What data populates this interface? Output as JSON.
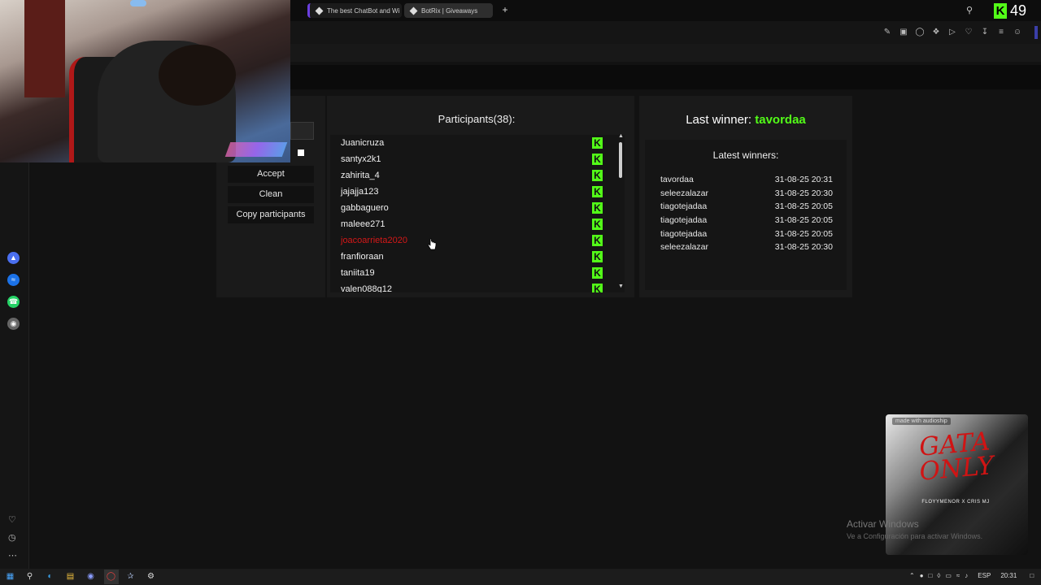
{
  "browser": {
    "tabs": [
      {
        "label": "The best ChatBot and Wi"
      },
      {
        "label": "BotRix | Giveaways"
      }
    ],
    "new_tab_icon": "+",
    "search_icon": "search-icon",
    "toolbar_icons": [
      "edit-icon",
      "camera-icon",
      "shield-icon",
      "extension-icon",
      "play-icon",
      "heart-icon",
      "download-icon",
      "menu-icon",
      "profile-icon"
    ]
  },
  "stream": {
    "viewer_count": "49",
    "badge": "K"
  },
  "actions": {
    "accept": "Accept",
    "clean": "Clean",
    "copy": "Copy participants"
  },
  "participants": {
    "title": "Participants(38):",
    "badge": "K",
    "list": [
      {
        "name": "Juanicruza",
        "mod": false
      },
      {
        "name": "santyx2k1",
        "mod": false
      },
      {
        "name": "zahirita_4",
        "mod": false
      },
      {
        "name": "jajajja123",
        "mod": false
      },
      {
        "name": "gabbaguero",
        "mod": false
      },
      {
        "name": "maleee271",
        "mod": false
      },
      {
        "name": "joacoarrieta2020",
        "mod": true
      },
      {
        "name": "franfioraan",
        "mod": false
      },
      {
        "name": "taniita19",
        "mod": false
      },
      {
        "name": "valen088g12",
        "mod": false
      }
    ]
  },
  "winners": {
    "last_label": "Last winner:",
    "last_name": "tavordaa",
    "latest_title": "Latest winners:",
    "latest": [
      {
        "name": "tavordaa",
        "date": "31-08-25 20:31"
      },
      {
        "name": "seleezalazar",
        "date": "31-08-25 20:30"
      },
      {
        "name": "tiagotejadaa",
        "date": "31-08-25 20:05"
      },
      {
        "name": "tiagotejadaa",
        "date": "31-08-25 20:05"
      },
      {
        "name": "tiagotejadaa",
        "date": "31-08-25 20:05"
      },
      {
        "name": "seleezalazar",
        "date": "31-08-25 20:30"
      }
    ]
  },
  "album": {
    "tag": "made with audioship",
    "title": "GATA ONLY",
    "artists": "FLOYYMENOR X CRIS MJ"
  },
  "watermark": {
    "title": "Activar Windows",
    "subtitle": "Ve a Configuración para activar Windows."
  },
  "taskbar": {
    "language": "ESP",
    "time": "20:31"
  },
  "colors": {
    "kick_green": "#53fc18",
    "mod_red": "#d41818",
    "panel": "#1a1a1a"
  }
}
